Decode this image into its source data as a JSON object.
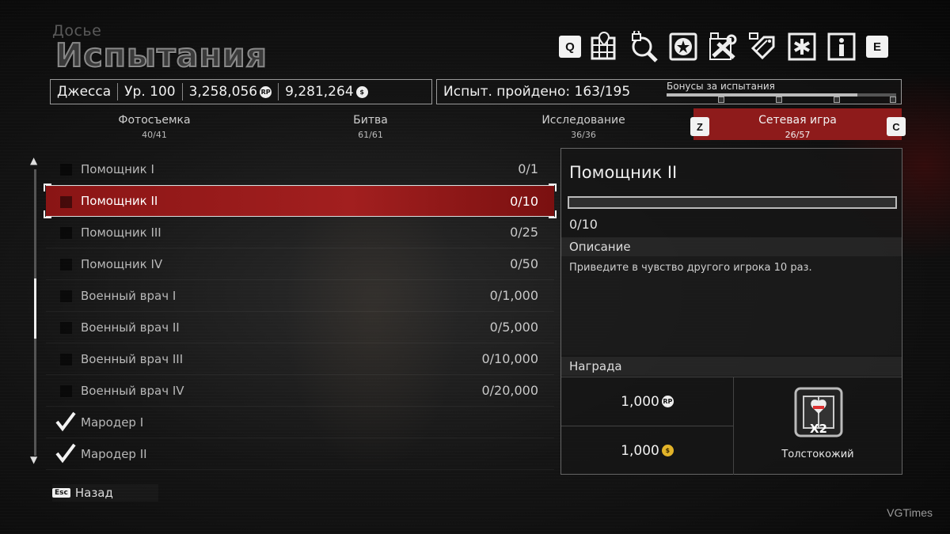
{
  "header": {
    "subtitle": "Досье",
    "title": "Испытания"
  },
  "topbar": {
    "left_key": "Q",
    "right_key": "E",
    "icons": [
      "map-grid-icon",
      "locked-search-icon",
      "star-badge-icon",
      "locked-tools-icon",
      "locked-tag-icon",
      "asterisk-icon",
      "info-icon"
    ]
  },
  "status": {
    "player_name": "Джесса",
    "level": "Ур. 100",
    "rp": "3,258,056",
    "rp_symbol": "RP",
    "money": "9,281,264",
    "money_symbol": "$",
    "challenges_done": "Испыт. пройдено: 163/195",
    "bonus_label": "Бонусы за испытания",
    "bonus_progress": 0.83
  },
  "tabs": [
    {
      "name": "Фотосъемка",
      "count": "40/41"
    },
    {
      "name": "Битва",
      "count": "61/61"
    },
    {
      "name": "Исследование",
      "count": "36/36"
    },
    {
      "name": "Сетевая игра",
      "count": "26/57"
    }
  ],
  "tab_keys": {
    "prev": "Z",
    "next": "C"
  },
  "list": [
    {
      "name": "Помощник I",
      "value": "0/1",
      "done": false
    },
    {
      "name": "Помощник II",
      "value": "0/10",
      "done": false,
      "selected": true
    },
    {
      "name": "Помощник III",
      "value": "0/25",
      "done": false
    },
    {
      "name": "Помощник IV",
      "value": "0/50",
      "done": false
    },
    {
      "name": "Военный врач I",
      "value": "0/1,000",
      "done": false
    },
    {
      "name": "Военный врач II",
      "value": "0/5,000",
      "done": false
    },
    {
      "name": "Военный врач III",
      "value": "0/10,000",
      "done": false
    },
    {
      "name": "Военный врач IV",
      "value": "0/20,000",
      "done": false
    },
    {
      "name": "Мародер I",
      "value": "",
      "done": true
    },
    {
      "name": "Мародер II",
      "value": "",
      "done": true
    }
  ],
  "back": {
    "key": "Esc",
    "label": "Назад"
  },
  "detail": {
    "title": "Помощник II",
    "progress_text": "0/10",
    "progress_fraction": 0,
    "desc_header": "Описание",
    "description": "Приведите в чувство другого игрока 10 раз.",
    "reward_header": "Награда",
    "reward_rp": "1,000",
    "reward_money": "1,000",
    "perk_badge": "X2",
    "perk_name": "Толстокожий"
  },
  "watermark": "VGTimes"
}
